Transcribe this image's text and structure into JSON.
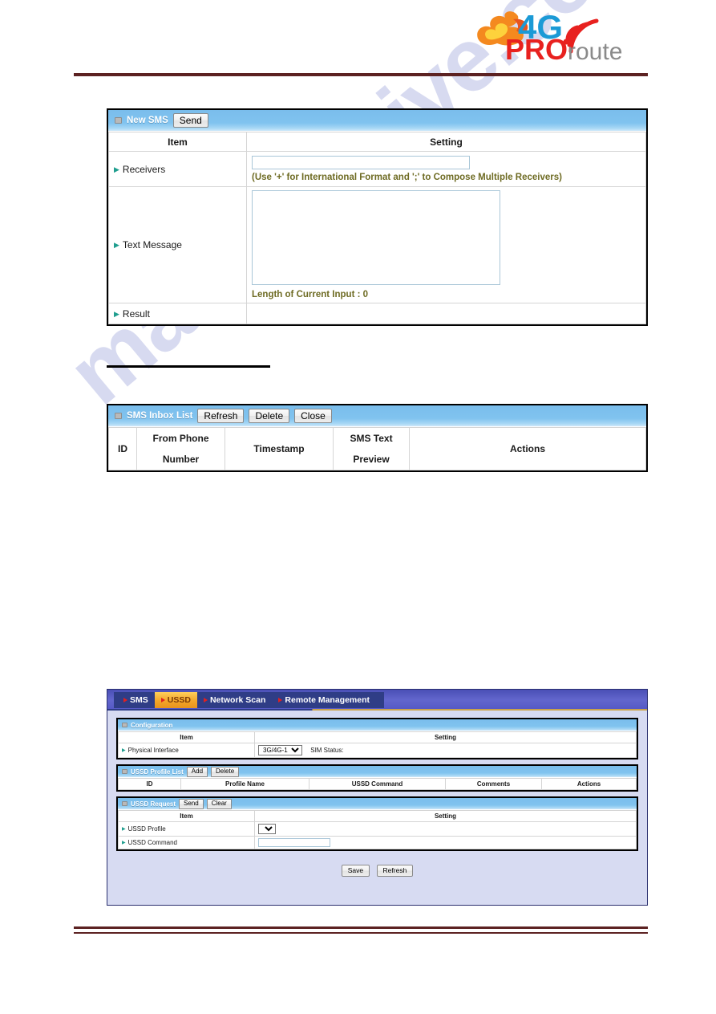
{
  "document": {
    "watermark": "manualshive.com"
  },
  "brand": {
    "name_4g": "4G",
    "name_pro": "PRO",
    "name_route": "route",
    "colors": {
      "blue": "#1b9ad6",
      "red": "#e8211f",
      "orange": "#f58220",
      "grey": "#8a8a8a"
    }
  },
  "new_sms_panel": {
    "title": "New SMS",
    "buttons": [
      {
        "label": "Send",
        "name": "send-button"
      }
    ],
    "columns": [
      "Item",
      "Setting"
    ],
    "rows": [
      {
        "item": "Receivers",
        "input_value": "",
        "hint": "(Use '+' for International Format and ';' to Compose Multiple Receivers)"
      },
      {
        "item": "Text Message",
        "textarea_value": "",
        "length_label": "Length of Current Input :",
        "length_value": "0"
      },
      {
        "item": "Result",
        "value": ""
      }
    ]
  },
  "inbox_panel": {
    "title": "SMS Inbox List",
    "buttons": [
      {
        "label": "Refresh",
        "name": "refresh-button"
      },
      {
        "label": "Delete",
        "name": "delete-button"
      },
      {
        "label": "Close",
        "name": "close-button"
      }
    ],
    "columns": [
      "ID",
      "From Phone\nNumber",
      "Timestamp",
      "SMS Text\nPreview",
      "Actions"
    ],
    "column_id": "ID",
    "column_from_line1": "From Phone",
    "column_from_line2": "Number",
    "column_timestamp": "Timestamp",
    "column_sms_line1": "SMS Text",
    "column_sms_line2": "Preview",
    "column_actions": "Actions",
    "rows": []
  },
  "ussd_window": {
    "tabs": [
      {
        "label": "SMS",
        "active": false
      },
      {
        "label": "USSD",
        "active": true
      },
      {
        "label": "Network Scan",
        "active": false
      },
      {
        "label": "Remote Management",
        "active": false
      }
    ],
    "configuration": {
      "title": "Configuration",
      "columns": [
        "Item",
        "Setting"
      ],
      "physical_interface_label": "Physical Interface",
      "physical_interface_value": "3G/4G-1",
      "physical_interface_options": [
        "3G/4G-1"
      ],
      "sim_status_label": "SIM Status:",
      "sim_status_value": ""
    },
    "profile_list": {
      "title": "USSD Profile List",
      "buttons": [
        {
          "label": "Add",
          "name": "add-button"
        },
        {
          "label": "Delete",
          "name": "delete-button"
        }
      ],
      "columns": [
        "ID",
        "Profile Name",
        "USSD Command",
        "Comments",
        "Actions"
      ],
      "col_id": "ID",
      "col_profile_name": "Profile Name",
      "col_ussd_command": "USSD Command",
      "col_comments": "Comments",
      "col_actions": "Actions",
      "rows": []
    },
    "request": {
      "title": "USSD Request",
      "buttons": [
        {
          "label": "Send",
          "name": "send-button"
        },
        {
          "label": "Clear",
          "name": "clear-button"
        }
      ],
      "columns": [
        "Item",
        "Setting"
      ],
      "col_item": "Item",
      "col_setting": "Setting",
      "profile_label": "USSD Profile",
      "profile_value": "",
      "command_label": "USSD Command",
      "command_value": ""
    },
    "footer_buttons": [
      {
        "label": "Save",
        "name": "save-button"
      },
      {
        "label": "Refresh",
        "name": "refresh-button"
      }
    ],
    "save_label": "Save",
    "refresh_label": "Refresh"
  }
}
